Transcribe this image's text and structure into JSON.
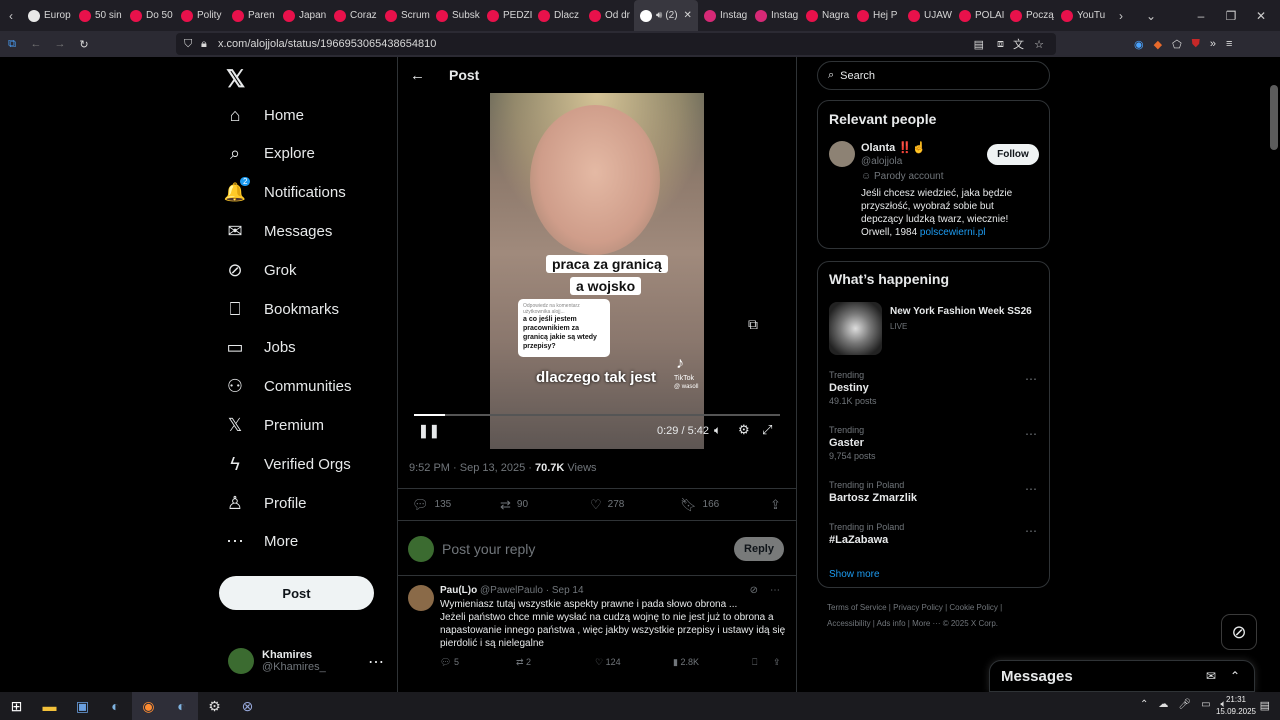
{
  "browser": {
    "tabs": [
      {
        "label": "Europ",
        "color": "#e8e8e8"
      },
      {
        "label": "50 sin",
        "color": "#e8114b"
      },
      {
        "label": "Do 50",
        "color": "#e8114b"
      },
      {
        "label": "Polity",
        "color": "#e8114b"
      },
      {
        "label": "Paren",
        "color": "#e8114b"
      },
      {
        "label": "Japan",
        "color": "#e8114b"
      },
      {
        "label": "Coraz",
        "color": "#e8114b"
      },
      {
        "label": "Scrum",
        "color": "#e8114b"
      },
      {
        "label": "Subsk",
        "color": "#e8114b"
      },
      {
        "label": "PEDZI",
        "color": "#e8114b"
      },
      {
        "label": "Dlacz",
        "color": "#e8114b"
      },
      {
        "label": "Od dr",
        "color": "#e8114b"
      },
      {
        "label": "(2)",
        "color": "#ffffff",
        "active": true
      },
      {
        "label": "Instag",
        "color": "#d62976"
      },
      {
        "label": "Instag",
        "color": "#d62976"
      },
      {
        "label": "Nagra",
        "color": "#e8114b"
      },
      {
        "label": "Hej P",
        "color": "#e8114b"
      },
      {
        "label": "UJAW",
        "color": "#e8114b"
      },
      {
        "label": "POLAI",
        "color": "#e8114b"
      },
      {
        "label": "Począ",
        "color": "#e8114b"
      },
      {
        "label": "YouTu",
        "color": "#e8114b"
      }
    ],
    "url": "x.com/alojjola/status/1966953065438654810"
  },
  "nav": {
    "items": [
      {
        "label": "Home",
        "icon": "home-icon",
        "glyph": "⌂"
      },
      {
        "label": "Explore",
        "icon": "search-icon",
        "glyph": "⌕"
      },
      {
        "label": "Notifications",
        "icon": "bell-icon",
        "glyph": "🔔",
        "badge": "2"
      },
      {
        "label": "Messages",
        "icon": "mail-icon",
        "glyph": "✉"
      },
      {
        "label": "Grok",
        "icon": "grok-icon",
        "glyph": "⊘"
      },
      {
        "label": "Bookmarks",
        "icon": "bookmark-icon",
        "glyph": "⎕"
      },
      {
        "label": "Jobs",
        "icon": "briefcase-icon",
        "glyph": "▭"
      },
      {
        "label": "Communities",
        "icon": "people-icon",
        "glyph": "⚇"
      },
      {
        "label": "Premium",
        "icon": "x-icon",
        "glyph": "𝕏"
      },
      {
        "label": "Verified Orgs",
        "icon": "bolt-icon",
        "glyph": "ϟ"
      },
      {
        "label": "Profile",
        "icon": "person-icon",
        "glyph": "♙"
      },
      {
        "label": "More",
        "icon": "more-icon",
        "glyph": "⋯"
      }
    ],
    "post_label": "Post",
    "account_name": "Khamires",
    "account_handle": "@Khamires_"
  },
  "post": {
    "header": "Post",
    "caption1": "praca za granicą",
    "caption2": "a wojsko",
    "caption3": "dlaczego tak jest",
    "bubble_head": "Odpowiedz na komentarz użytkownika alojj...",
    "bubble_text": "a co jeśli jestem pracownikiem za granicą jakie są wtedy przepisy?",
    "tiktok": "TikTok",
    "tiktok_handle": "@ wasoll",
    "time": "0:29 / 5:42",
    "progress": 0.085,
    "timestamp": "9:52 PM · Sep 13, 2025 · ",
    "views": "70.7K",
    "views_label": " Views",
    "replies": "135",
    "reposts": "90",
    "likes": "278",
    "bookmarks": "166",
    "reply_placeholder": "Post your reply",
    "reply_button": "Reply"
  },
  "comment": {
    "name": "Pau(L)o",
    "handle": "@PawelPaulo · Sep 14",
    "line1": "Wymieniasz tutaj wszystkie aspekty prawne i pada słowo obrona ...",
    "line2": "Jeżeli państwo chce mnie wysłać na cudzą wojnę to nie jest już to obrona a napastowanie innego państwa , więc jakby wszystkie przepisy i ustawy idą się pierdolić i są nielegalne",
    "replies": "5",
    "reposts": "2",
    "likes": "124",
    "views": "2.8K"
  },
  "right": {
    "search_placeholder": "Search",
    "relevant_title": "Relevant people",
    "person_name": "Olanta ‼️☝️",
    "person_handle": "@alojjola",
    "person_tag": "Parody account",
    "follow": "Follow",
    "bio": "Jeśli chcesz wiedzieć, jaka będzie przyszłość, wyobraź sobie but depczący ludzką twarz, wiecznie! Orwell, 1984 ",
    "bio_link": "polscewierni.pl",
    "happening_title": "What’s happening",
    "event_title": "New York Fashion Week SS26",
    "event_status": "LIVE",
    "trends": [
      {
        "context": "Trending",
        "title": "Destiny",
        "count": "49.1K posts"
      },
      {
        "context": "Trending",
        "title": "Gaster",
        "count": "9,754 posts"
      },
      {
        "context": "Trending in Poland",
        "title": "Bartosz Zmarzlik",
        "count": ""
      },
      {
        "context": "Trending in Poland",
        "title": "#LaZabawa",
        "count": ""
      }
    ],
    "show_more": "Show more",
    "footer1": "Terms of Service  |  Privacy Policy  |  Cookie Policy  |",
    "footer2": "Accessibility  |  Ads info  |  More ···  © 2025 X Corp."
  },
  "messages_panel": "Messages",
  "taskbar": {
    "time": "21:31",
    "date": "15.09.2025"
  }
}
